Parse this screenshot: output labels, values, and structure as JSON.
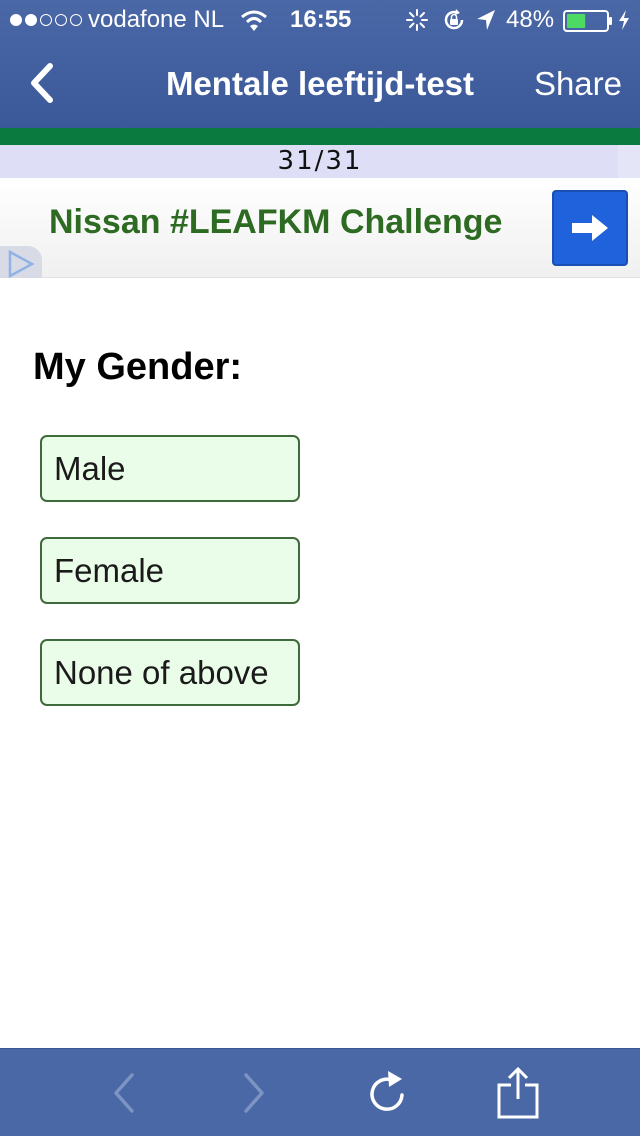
{
  "status_bar": {
    "carrier": "vodafone NL",
    "time": "16:55",
    "battery_percent": "48%",
    "battery_level": 0.48
  },
  "nav": {
    "back_icon": "chevron-left-icon",
    "title": "Mentale leeftijd-test",
    "share_label": "Share"
  },
  "progress": {
    "text": "31/31",
    "fraction": 0.965
  },
  "ad": {
    "headline": "Nissan #LEAFKM Challenge",
    "arrow_icon": "arrow-right-icon",
    "choices_icon": "ad-choices-icon"
  },
  "question": {
    "heading": "My Gender:",
    "options": [
      "Male",
      "Female",
      "None of above"
    ]
  },
  "toolbar": {
    "icons": [
      "back-arrow-icon",
      "forward-arrow-icon",
      "reload-icon",
      "share-icon"
    ]
  },
  "colors": {
    "header_blue": "#3b5899",
    "accent_green": "#0b7a3e",
    "ad_text_green": "#2d6a22",
    "option_bg": "#eafde9",
    "ad_button_blue": "#1f62dc"
  }
}
